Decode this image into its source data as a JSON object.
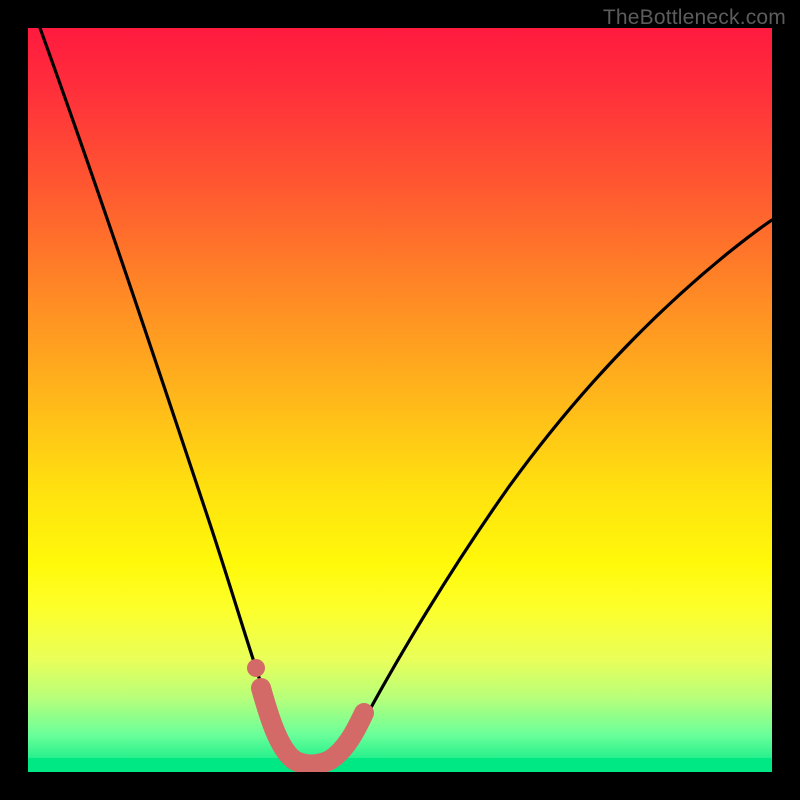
{
  "watermark": "TheBottleneck.com",
  "colors": {
    "background": "#000000",
    "curve": "#000000",
    "marker_stroke": "#d46a68",
    "marker_fill": "#d46a68",
    "gradient_stops": [
      "#ff1a3f",
      "#ff5a30",
      "#ffb81a",
      "#fff90a",
      "#b8ff7a",
      "#00e884"
    ]
  },
  "chart_data": {
    "type": "line",
    "title": "",
    "xlabel": "",
    "ylabel": "",
    "xlim": [
      0,
      100
    ],
    "ylim": [
      0,
      100
    ],
    "series": [
      {
        "name": "bottleneck-curve",
        "x_percent": [
          2,
          5,
          8,
          11,
          14,
          17,
          20,
          23,
          26,
          28,
          30,
          32,
          33.5,
          35,
          37,
          39,
          41,
          44,
          48,
          54,
          60,
          66,
          72,
          78,
          85,
          92,
          100
        ],
        "y_percent": [
          100,
          93,
          85,
          77,
          69,
          61,
          53,
          44,
          35,
          27,
          20,
          13,
          8,
          4,
          2,
          1,
          2,
          5,
          11,
          21,
          31,
          40,
          48,
          55,
          62,
          68,
          74
        ]
      }
    ],
    "markers": {
      "name": "highlight-zone",
      "type": "thick-segment",
      "x_percent": [
        30.5,
        32.5,
        34,
        36,
        38,
        40,
        42,
        44
      ],
      "y_percent": [
        13,
        7,
        3,
        1.5,
        1.2,
        1.5,
        3.5,
        7
      ],
      "dot": {
        "x_percent": 30.5,
        "y_percent": 13
      }
    }
  }
}
